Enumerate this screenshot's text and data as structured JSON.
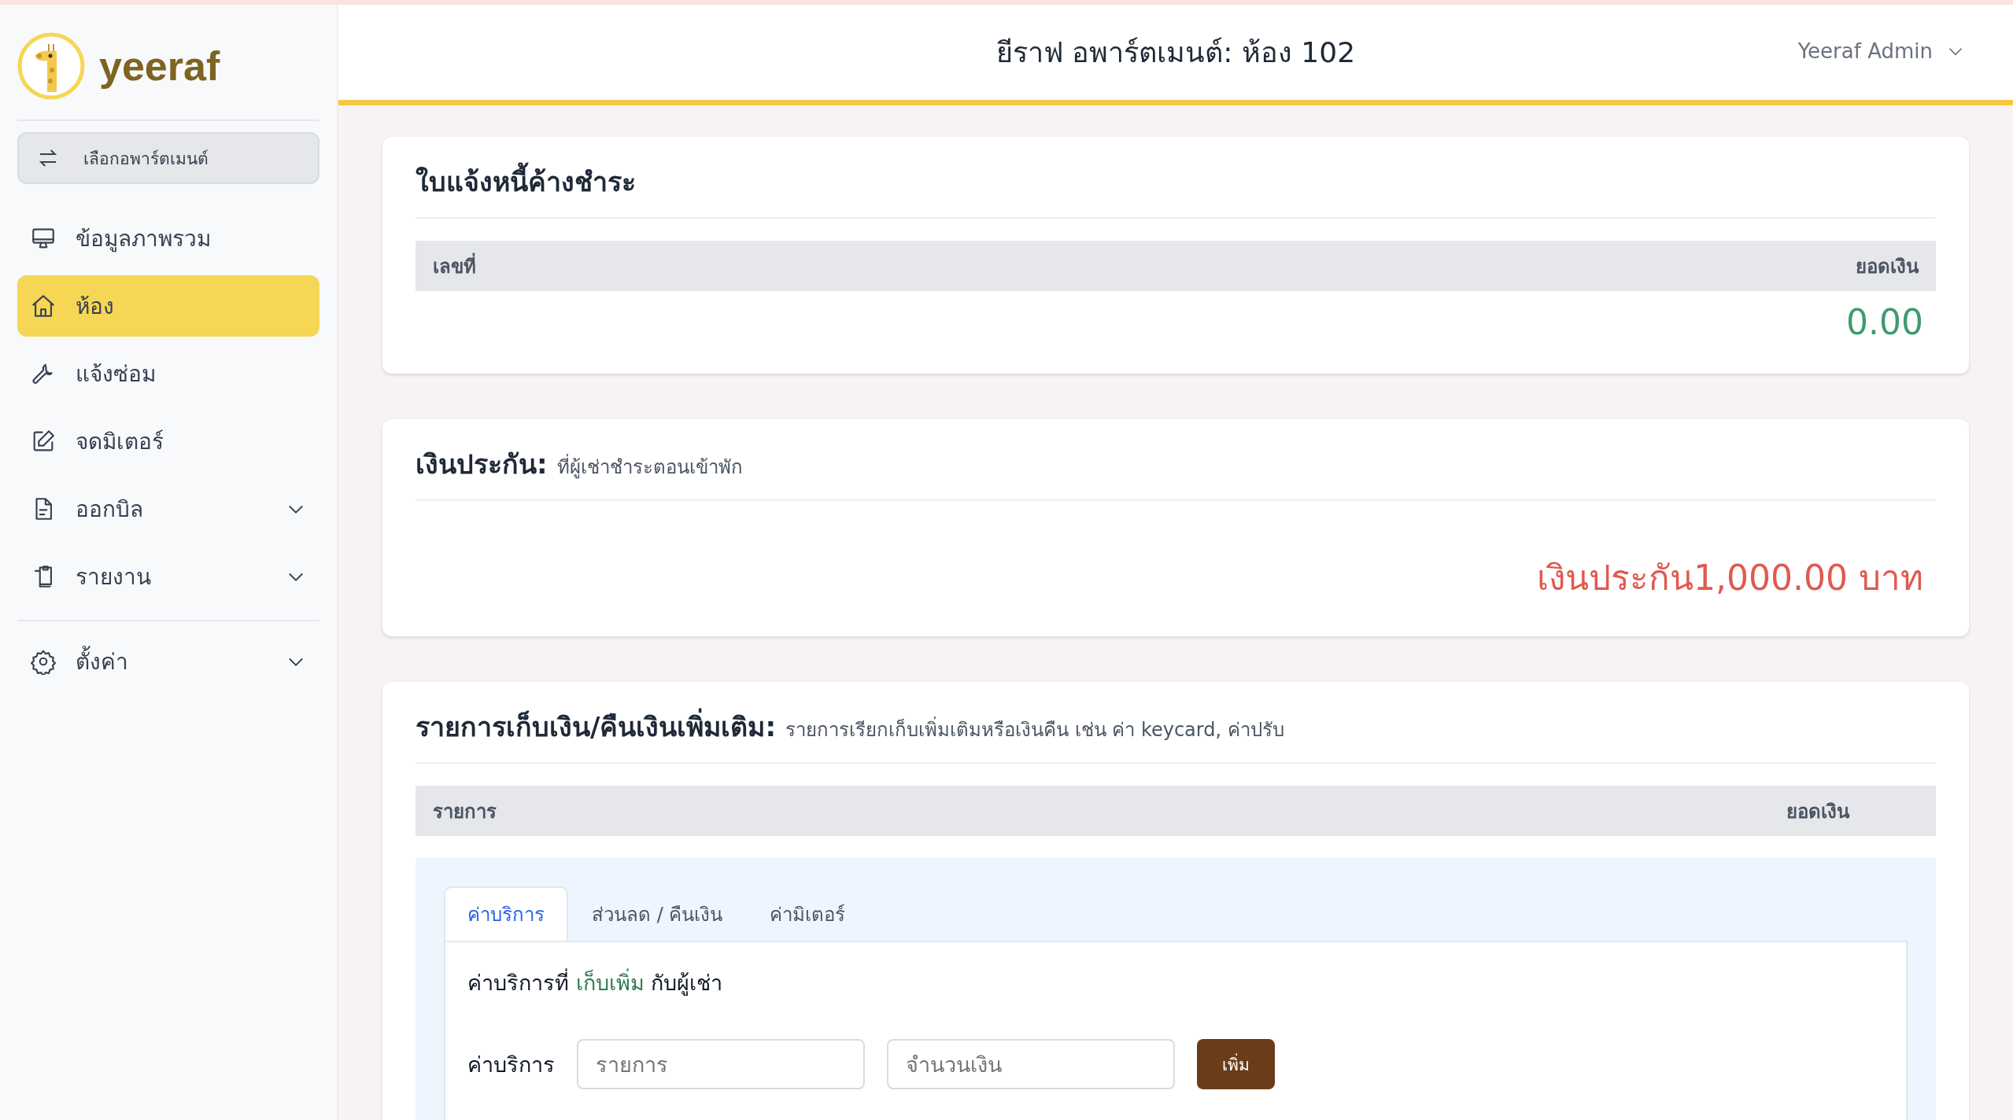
{
  "sidebar": {
    "logo_text": "yeeraf",
    "switch_button": "เลือกอพาร์ตเมนต์",
    "items": [
      {
        "label": "ข้อมูลภาพรวม",
        "kind": "link",
        "selected": false
      },
      {
        "label": "ห้อง",
        "kind": "link",
        "selected": true
      },
      {
        "label": "แจ้งซ่อม",
        "kind": "link",
        "selected": false
      },
      {
        "label": "จดมิเตอร์",
        "kind": "link",
        "selected": false
      },
      {
        "label": "ออกบิล",
        "kind": "group",
        "selected": false
      },
      {
        "label": "รายงาน",
        "kind": "group",
        "selected": false
      },
      {
        "label": "ตั้งค่า",
        "kind": "group",
        "selected": false
      }
    ]
  },
  "header": {
    "title": "ยีราฟ อพาร์ตเมนต์: ห้อง 102",
    "user": "Yeeraf Admin"
  },
  "invoices": {
    "title": "ใบแจ้งหนี้ค้างชำระ",
    "columns": [
      "เลขที่",
      "ยอดเงิน"
    ],
    "total": "0.00"
  },
  "deposit": {
    "title": "เงินประกัน:",
    "subtitle": "ที่ผู้เช่าชำระตอนเข้าพัก",
    "amount": "เงินประกัน1,000.00 บาท"
  },
  "extras": {
    "title": "รายการเก็บเงิน/คืนเงินเพิ่มเติม:",
    "subtitle": "รายการเรียกเก็บเพิ่มเติมหรือเงินคืน เช่น ค่า keycard, ค่าปรับ",
    "columns": [
      "รายการ",
      "ยอดเงิน"
    ],
    "tabs": [
      {
        "label": "ค่าบริการ",
        "selected": true
      },
      {
        "label": "ส่วนลด / คืนเงิน",
        "selected": false
      },
      {
        "label": "ค่ามิเตอร์",
        "selected": false
      }
    ],
    "note": {
      "before": "ค่าบริการที่",
      "highlight": "เก็บเพิ่ม",
      "after": "กับผู้เช่า"
    },
    "form": {
      "label": "ค่าบริการ",
      "item_placeholder": "รายการ",
      "amount_placeholder": "จำนวนเงิน",
      "button": "เพิ่ม"
    }
  }
}
